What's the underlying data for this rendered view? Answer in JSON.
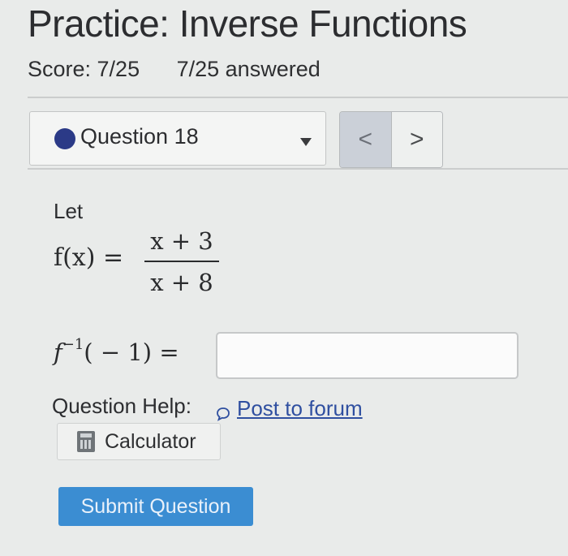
{
  "page": {
    "title": "Practice: Inverse Functions",
    "score": "Score: 7/25",
    "answered": "7/25 answered"
  },
  "question_nav": {
    "current": "Question 18",
    "prev_symbol": "<",
    "next_symbol": ">"
  },
  "problem": {
    "intro": "Let",
    "function_lhs": "f(x) =",
    "numerator": "x + 3",
    "denominator": "x + 8",
    "inverse_prompt_base": "f",
    "inverse_prompt_sup": "−1",
    "inverse_prompt_rest": "( − 1) =",
    "answer_value": ""
  },
  "help": {
    "label": "Question Help:",
    "forum_link": "Post to forum",
    "calculator": "Calculator"
  },
  "actions": {
    "submit": "Submit Question"
  },
  "colors": {
    "dot": "#2b3a87",
    "submit_bg": "#3b8dd2",
    "link": "#2f4fa0"
  }
}
